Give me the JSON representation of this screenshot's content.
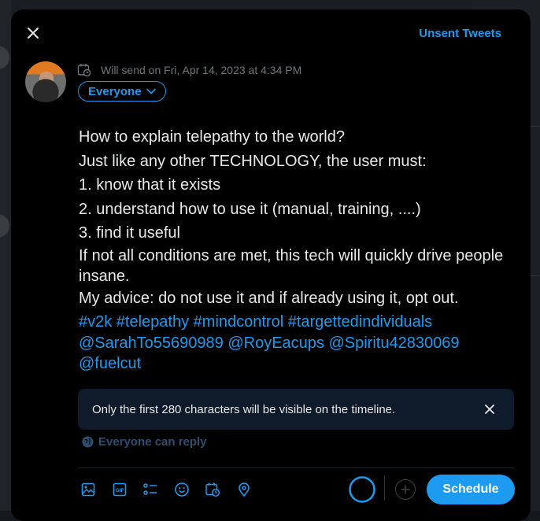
{
  "header": {
    "unsent_label": "Unsent Tweets"
  },
  "schedule": {
    "text": "Will send on Fri, Apr 14, 2023 at 4:34 PM"
  },
  "audience": {
    "label": "Everyone"
  },
  "tweet": {
    "lines": [
      "How to explain telepathy to the world?",
      "Just like any other TECHNOLOGY, the user must:",
      "1. know that it exists",
      "2. understand how to use it (manual, training, ....)",
      "3. find it useful",
      "If not all conditions are met, this tech will quickly drive people insane.",
      "My advice: do not use it and if already using it, opt out."
    ],
    "tags_line1": "#v2k #telepathy #mindcontrol #targettedindividuals",
    "tags_line2": "@SarahTo55690989 @RoyEacups @Spiritu42830069",
    "tags_line3": "@fuelcut"
  },
  "notice": {
    "text": "Only the first 280 characters will be visible on the timeline."
  },
  "reply": {
    "label": "Everyone can reply"
  },
  "actions": {
    "schedule_label": "Schedule"
  },
  "colors": {
    "accent": "#1d9bf0",
    "background": "#000000",
    "notice_bg": "#0f1a2b"
  }
}
